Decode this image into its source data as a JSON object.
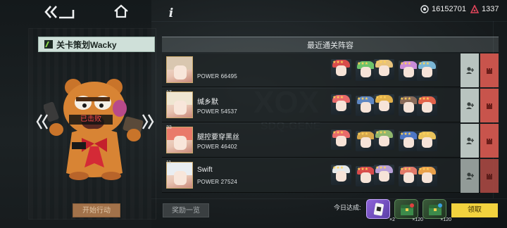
{
  "nav": {
    "back_icon": "double-chevron-left-icon",
    "home_icon": "home-icon",
    "info_label": "i"
  },
  "currencies": [
    {
      "icon": "crystal-icon",
      "value": "16152701"
    },
    {
      "icon": "red-triangle-icon",
      "value": "1337"
    }
  ],
  "stage": {
    "title": "关卡策划Wacky",
    "status": "已击败"
  },
  "list": {
    "title": "最近通关阵容",
    "rows": [
      {
        "level": "",
        "name": "",
        "power": "POWER 66495",
        "hair": "#d9c7b0",
        "team": [
          "#d84b4b",
          "#6cc36a",
          "#e8c27b",
          "#c98bd8",
          "#7ab6d6"
        ]
      },
      {
        "level": "17",
        "name": "缄乡默",
        "power": "POWER 54537",
        "hair": "#efe6d2",
        "team": [
          "#e86a6a",
          "#5e86c2",
          "#e2b04a",
          "#8a6b5a",
          "#e2624a"
        ]
      },
      {
        "level": "33",
        "name": "腿控要穿黑丝",
        "power": "POWER 46402",
        "hair": "#e97a6a",
        "team": [
          "#e86a6a",
          "#d5a64c",
          "#8fb66c",
          "#4d76c4",
          "#e9c25a"
        ]
      },
      {
        "level": "11",
        "name": "Swift",
        "power": "POWER 27524",
        "hair": "#e9eef2",
        "team": [
          "#e5e8ea",
          "#d84b4b",
          "#b8a0d8",
          "#e27a6a",
          "#e9a04a"
        ]
      }
    ]
  },
  "buttons": {
    "start": "开始行动",
    "rewards": "奖励一览",
    "claim": "领取"
  },
  "daily": {
    "label": "今日达成:",
    "rewards": [
      {
        "icon": "card-icon",
        "count": "×2"
      },
      {
        "icon": "green-chest-icon",
        "count": "×120"
      },
      {
        "icon": "green-chest-icon",
        "count": "×120"
      }
    ]
  },
  "colors": {
    "accent_yellow": "#f2d23e",
    "fight_red": "#c8544c",
    "add_gray": "#b9c4c0",
    "start_brown": "#a2724a"
  }
}
